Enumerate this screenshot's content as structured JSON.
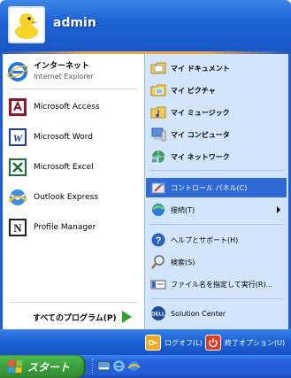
{
  "user": {
    "name": "admin"
  },
  "left_items": [
    {
      "label": "インターネット",
      "sublabel": "Internet Explorer",
      "icon": "internet-explorer-icon"
    },
    {
      "label": "Microsoft Access",
      "icon": "access-icon"
    },
    {
      "label": "Microsoft Word",
      "icon": "word-icon"
    },
    {
      "label": "Microsoft Excel",
      "icon": "excel-icon"
    },
    {
      "label": "Outlook Express",
      "icon": "outlook-express-icon"
    },
    {
      "label": "Profile Manager",
      "icon": "profile-manager-icon"
    }
  ],
  "all_programs": {
    "label": "すべてのプログラム(P)"
  },
  "right_items": [
    {
      "label": "マイ ドキュメント",
      "icon": "my-documents-icon"
    },
    {
      "label": "マイ ピクチャ",
      "icon": "my-pictures-icon"
    },
    {
      "label": "マイ ミュージック",
      "icon": "my-music-icon"
    },
    {
      "label": "マイ コンピュータ",
      "icon": "my-computer-icon"
    },
    {
      "label": "マイ ネットワーク",
      "icon": "my-network-icon"
    },
    {
      "label": "コントロール パネル(C)",
      "icon": "control-panel-icon",
      "selected": true
    },
    {
      "label": "接続(T)",
      "icon": "connect-icon",
      "has_submenu": true
    },
    {
      "label": "ヘルプとサポート(H)",
      "icon": "help-icon"
    },
    {
      "label": "検索(S)",
      "icon": "search-icon"
    },
    {
      "label": "ファイル名を指定して実行(R)...",
      "icon": "run-icon"
    },
    {
      "label": "Solution Center",
      "icon": "dell-icon"
    }
  ],
  "footer": {
    "logoff": "ログオフ(L)",
    "shutdown": "終了オプション(U)"
  },
  "taskbar": {
    "start_label": "スタート"
  }
}
